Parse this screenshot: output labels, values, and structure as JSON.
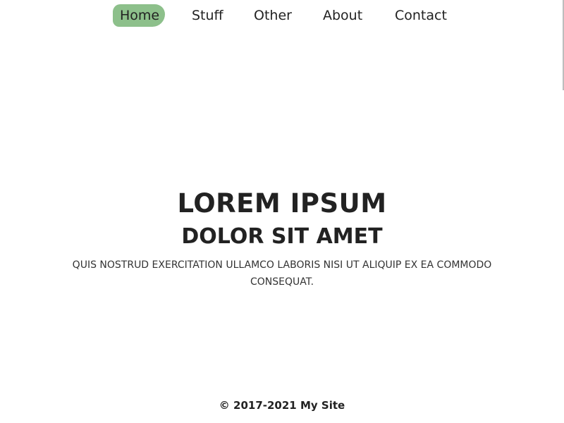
{
  "nav": {
    "items": [
      {
        "label": "Home",
        "active": true
      },
      {
        "label": "Stuff",
        "active": false
      },
      {
        "label": "Other",
        "active": false
      },
      {
        "label": "About",
        "active": false
      },
      {
        "label": "Contact",
        "active": false
      }
    ],
    "active_highlight_color": "#8dc08b"
  },
  "hero": {
    "title": "LOREM IPSUM",
    "subtitle": "DOLOR SIT AMET",
    "body": "QUIS NOSTRUD EXERCITATION ULLAMCO LABORIS NISI UT ALIQUIP EX EA COMMODO CONSEQUAT."
  },
  "footer": {
    "text": "© 2017-2021 My Site"
  }
}
